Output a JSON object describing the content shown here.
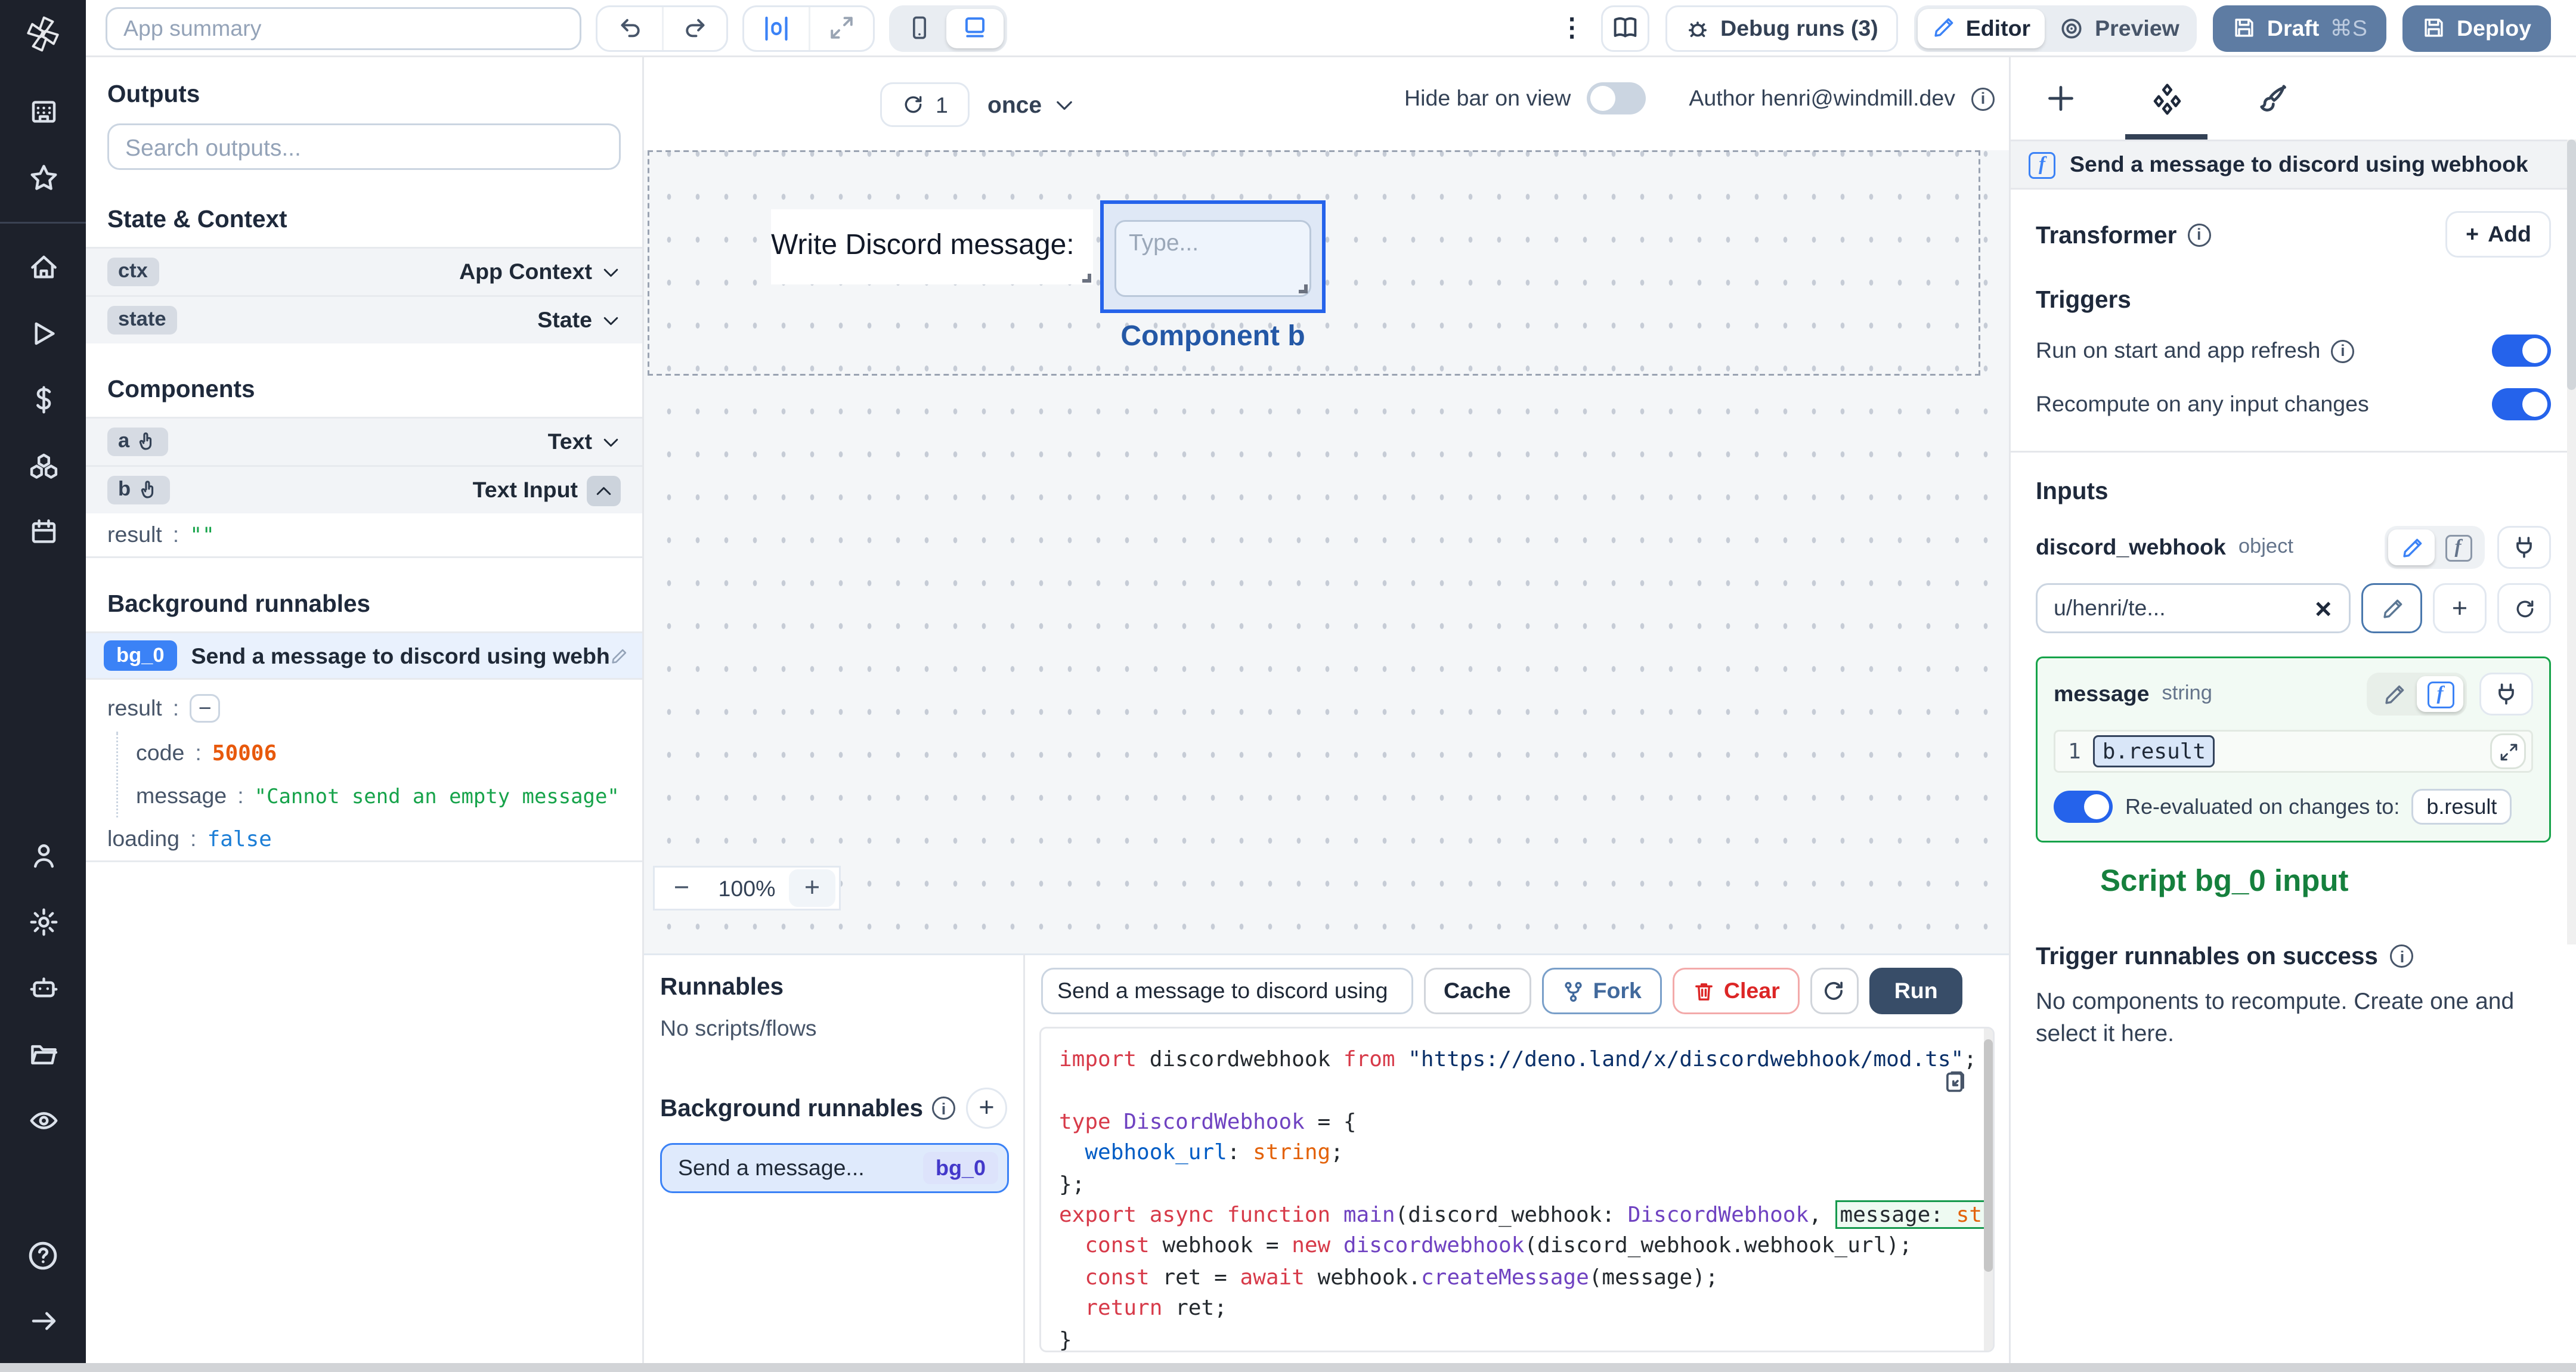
{
  "topbar": {
    "app_summary_placeholder": "App summary",
    "debug_runs": "Debug runs (3)",
    "editor": "Editor",
    "preview": "Preview",
    "draft": "Draft",
    "draft_shortcut": "⌘S",
    "deploy": "Deploy"
  },
  "sidebar_icons": [
    "windmill-logo",
    "building",
    "star",
    "home",
    "play",
    "dollar",
    "cubes",
    "calendar",
    "person",
    "gear",
    "robot",
    "folder",
    "eye",
    "help",
    "arrow-right"
  ],
  "outputs": {
    "title": "Outputs",
    "search_placeholder": "Search outputs...",
    "state_context_title": "State & Context",
    "rows": [
      {
        "badge": "ctx",
        "type": "App Context"
      },
      {
        "badge": "state",
        "type": "State"
      }
    ],
    "components_title": "Components",
    "components": [
      {
        "badge": "a",
        "type": "Text"
      },
      {
        "badge": "b",
        "type": "Text Input"
      }
    ],
    "b_result": {
      "key": "result",
      "colon": ":",
      "value": "\"\""
    },
    "bg_title": "Background runnables",
    "bg_badge": "bg_0",
    "bg_name": "Send a message to discord using webhook",
    "bg_result_key": "result",
    "bg_fields": [
      {
        "key": "code",
        "value": "50006"
      },
      {
        "key": "message",
        "value": "\"Cannot send an empty message\""
      },
      {
        "key": "loading",
        "value": "false"
      }
    ],
    "colon": ":"
  },
  "canvas": {
    "refresh_count": "1",
    "schedule": "once",
    "hide_bar_label": "Hide bar on view",
    "author_label": "Author henri@windmill.dev",
    "text_component": "Write Discord message:",
    "input_placeholder": "Type...",
    "selected_label": "Component b",
    "zoom_out": "−",
    "zoom_level": "100%",
    "zoom_in": "+"
  },
  "runnables": {
    "title": "Runnables",
    "empty": "No scripts/flows",
    "bg_title": "Background runnables",
    "item_name": "Send a message...",
    "item_badge": "bg_0"
  },
  "code_panel": {
    "tab": "Send a message to discord using",
    "cache": "Cache",
    "fork": "Fork",
    "clear": "Clear",
    "run": "Run",
    "lines": [
      [
        {
          "c": "kw",
          "t": "import "
        },
        {
          "c": "pl",
          "t": "discordwebhook "
        },
        {
          "c": "kw",
          "t": "from "
        },
        {
          "c": "str",
          "t": "\"https://deno.land/x/discordwebhook/mod.ts\""
        },
        {
          "c": "pl",
          "t": ";"
        }
      ],
      [],
      [
        {
          "c": "kw",
          "t": "type "
        },
        {
          "c": "id",
          "t": "DiscordWebhook"
        },
        {
          "c": "pl",
          "t": " = {"
        }
      ],
      [
        {
          "c": "pl",
          "t": "  "
        },
        {
          "c": "prop",
          "t": "webhook_url"
        },
        {
          "c": "pl",
          "t": ": "
        },
        {
          "c": "typ",
          "t": "string"
        },
        {
          "c": "pl",
          "t": ";"
        }
      ],
      [
        {
          "c": "pl",
          "t": "};"
        }
      ],
      [
        {
          "c": "kw",
          "t": "export async function "
        },
        {
          "c": "id",
          "t": "main"
        },
        {
          "c": "pl",
          "t": "(discord_webhook: "
        },
        {
          "c": "id",
          "t": "DiscordWebhook"
        },
        {
          "c": "pl",
          "t": ", "
        },
        {
          "c": "pl",
          "t": "message: ",
          "h": true
        },
        {
          "c": "typ",
          "t": "string",
          "h": true
        }
      ],
      [
        {
          "c": "pl",
          "t": "  "
        },
        {
          "c": "kw",
          "t": "const "
        },
        {
          "c": "pl",
          "t": "webhook = "
        },
        {
          "c": "kw",
          "t": "new "
        },
        {
          "c": "id",
          "t": "discordwebhook"
        },
        {
          "c": "pl",
          "t": "(discord_webhook.webhook_url);"
        }
      ],
      [
        {
          "c": "pl",
          "t": "  "
        },
        {
          "c": "kw",
          "t": "const "
        },
        {
          "c": "pl",
          "t": "ret = "
        },
        {
          "c": "kw",
          "t": "await "
        },
        {
          "c": "pl",
          "t": "webhook."
        },
        {
          "c": "id",
          "t": "createMessage"
        },
        {
          "c": "pl",
          "t": "(message);"
        }
      ],
      [
        {
          "c": "pl",
          "t": "  "
        },
        {
          "c": "kw",
          "t": "return "
        },
        {
          "c": "pl",
          "t": "ret;"
        }
      ],
      [
        {
          "c": "pl",
          "t": "}"
        }
      ]
    ]
  },
  "right_panel": {
    "header": "Send a message to discord using webhook",
    "transformer_title": "Transformer",
    "add_label": "Add",
    "triggers_title": "Triggers",
    "trigger_rows": [
      {
        "label": "Run on start and app refresh"
      },
      {
        "label": "Recompute on any input changes"
      }
    ],
    "inputs_title": "Inputs",
    "discord_webhook": {
      "name": "discord_webhook",
      "type": "object",
      "value": "u/henri/te..."
    },
    "message": {
      "name": "message",
      "type": "string",
      "line_no": "1",
      "expr": "b.result",
      "reeval_label": "Re-evaluated on changes to:",
      "reeval_target": "b.result"
    },
    "annotation": "Script bg_0 input",
    "on_success_title": "Trigger runnables on success",
    "on_success_body": "No components to recompute. Create one and select it here."
  },
  "colors": {
    "accent_blue": "#3b82f6",
    "selection_blue": "#2563eb",
    "draft_deploy": "#5e7ca3",
    "run_button": "#384d68",
    "highlight_green": "#16a34a",
    "annotation_green": "#15803d",
    "annotation_blue": "#2458a6",
    "value_orange": "#e8590c",
    "value_green": "#16a34a",
    "value_blue": "#1c7ed6"
  }
}
